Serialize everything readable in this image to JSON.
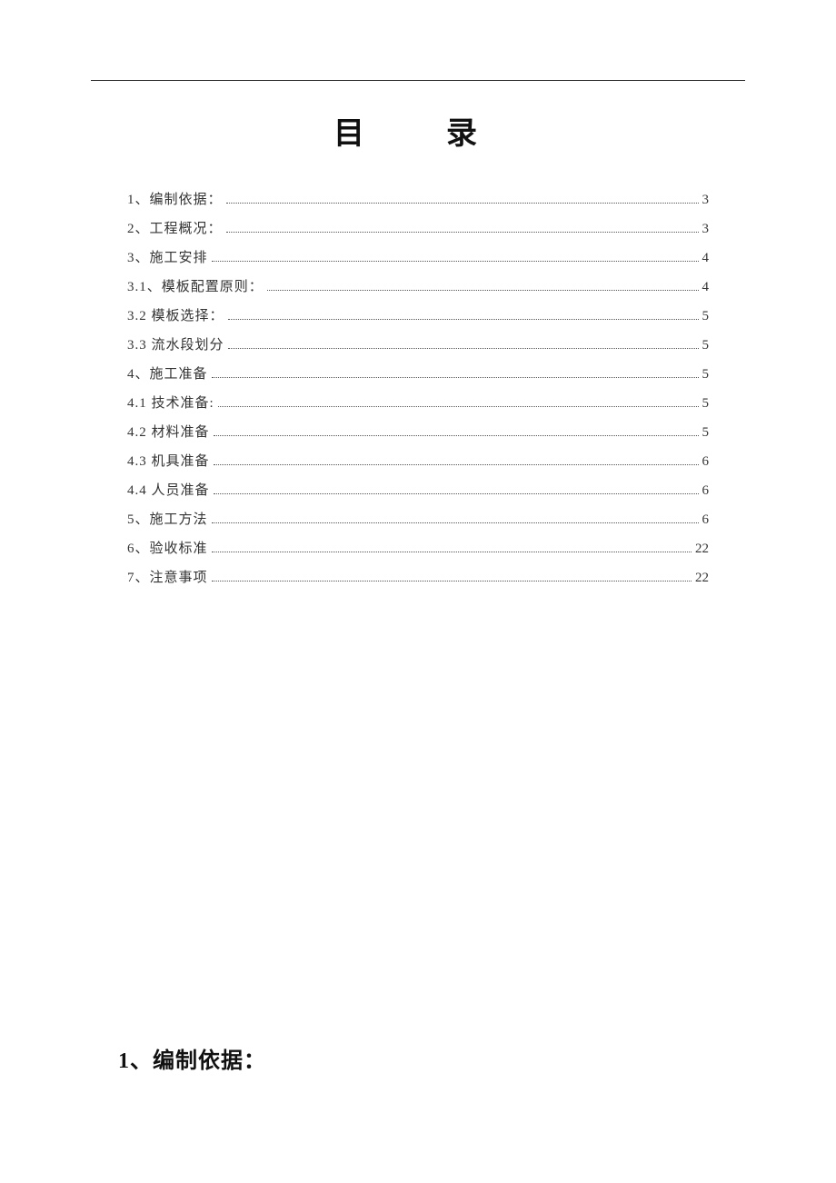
{
  "title": "目　录",
  "toc": [
    {
      "label": "1、编制依据：",
      "page": "3"
    },
    {
      "label": "2、工程概况：",
      "page": "3"
    },
    {
      "label": "3、施工安排",
      "page": "4"
    },
    {
      "label": "3.1、模板配置原则：",
      "page": "4"
    },
    {
      "label": "3.2 模板选择：",
      "page": "5"
    },
    {
      "label": "3.3 流水段划分",
      "page": "5"
    },
    {
      "label": "4、施工准备",
      "page": "5"
    },
    {
      "label": "4.1 技术准备:",
      "page": "5"
    },
    {
      "label": "4.2 材料准备",
      "page": "5"
    },
    {
      "label": "4.3 机具准备",
      "page": "6"
    },
    {
      "label": "4.4 人员准备",
      "page": "6"
    },
    {
      "label": "5、施工方法",
      "page": "6"
    },
    {
      "label": "6、验收标准",
      "page": "22"
    },
    {
      "label": "7、注意事项",
      "page": "22"
    }
  ],
  "section_heading": "1、编制依据："
}
